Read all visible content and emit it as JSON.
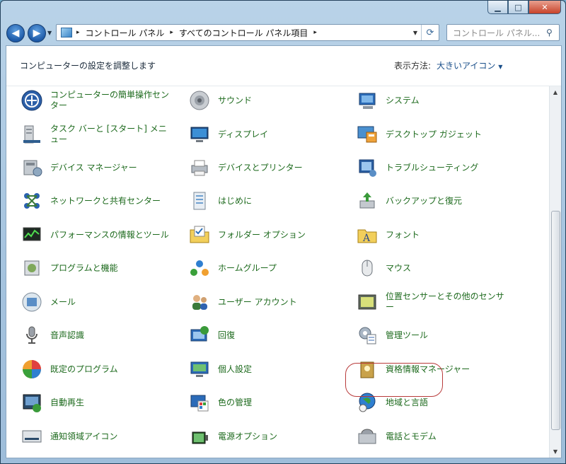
{
  "window": {
    "caption_buttons": {
      "minimize": "▁",
      "maximize": "□",
      "close": "✕"
    }
  },
  "navbar": {
    "back_glyph": "◀",
    "forward_glyph": "▶",
    "crumbs": [
      "コントロール パネル",
      "すべてのコントロール パネル項目"
    ],
    "crumb_separator": "▸",
    "search_placeholder": "コントロール パネル...",
    "icons": [
      "back-icon",
      "forward-icon",
      "control-panel-icon",
      "refresh-icon",
      "search-icon"
    ]
  },
  "header": {
    "title": "コンピューターの設定を調整します",
    "view_label": "表示方法:",
    "view_value": "大きいアイコン"
  },
  "items": [
    {
      "label": "コンピューターの簡単操作センター",
      "icon": "ease-of-access-icon"
    },
    {
      "label": "サウンド",
      "icon": "sound-icon"
    },
    {
      "label": "システム",
      "icon": "system-icon"
    },
    {
      "label": "タスク バーと [スタート] メニュー",
      "icon": "taskbar-icon"
    },
    {
      "label": "ディスプレイ",
      "icon": "display-icon"
    },
    {
      "label": "デスクトップ ガジェット",
      "icon": "gadgets-icon"
    },
    {
      "label": "デバイス マネージャー",
      "icon": "device-manager-icon"
    },
    {
      "label": "デバイスとプリンター",
      "icon": "printer-icon"
    },
    {
      "label": "トラブルシューティング",
      "icon": "troubleshooting-icon"
    },
    {
      "label": "ネットワークと共有センター",
      "icon": "network-icon"
    },
    {
      "label": "はじめに",
      "icon": "getting-started-icon"
    },
    {
      "label": "バックアップと復元",
      "icon": "backup-icon"
    },
    {
      "label": "パフォーマンスの情報とツール",
      "icon": "performance-icon"
    },
    {
      "label": "フォルダー オプション",
      "icon": "folder-options-icon"
    },
    {
      "label": "フォント",
      "icon": "fonts-icon"
    },
    {
      "label": "プログラムと機能",
      "icon": "programs-icon"
    },
    {
      "label": "ホームグループ",
      "icon": "homegroup-icon"
    },
    {
      "label": "マウス",
      "icon": "mouse-icon"
    },
    {
      "label": "メール",
      "icon": "mail-icon"
    },
    {
      "label": "ユーザー アカウント",
      "icon": "user-accounts-icon"
    },
    {
      "label": "位置センサーとその他のセンサー",
      "icon": "sensors-icon"
    },
    {
      "label": "音声認識",
      "icon": "microphone-icon"
    },
    {
      "label": "回復",
      "icon": "recovery-icon"
    },
    {
      "label": "管理ツール",
      "icon": "admin-tools-icon"
    },
    {
      "label": "既定のプログラム",
      "icon": "default-programs-icon"
    },
    {
      "label": "個人設定",
      "icon": "personalization-icon"
    },
    {
      "label": "資格情報マネージャー",
      "icon": "credential-manager-icon"
    },
    {
      "label": "自動再生",
      "icon": "autoplay-icon"
    },
    {
      "label": "色の管理",
      "icon": "color-management-icon"
    },
    {
      "label": "地域と言語",
      "icon": "region-language-icon"
    },
    {
      "label": "通知領域アイコン",
      "icon": "notification-icons-icon"
    },
    {
      "label": "電源オプション",
      "icon": "power-options-icon"
    },
    {
      "label": "電話とモデム",
      "icon": "phone-modem-icon"
    }
  ],
  "highlighted_item": "管理ツール",
  "colors": {
    "link_green": "#1d6a1d",
    "link_blue": "#1a4f8a",
    "highlight_red": "#b83a3a"
  }
}
